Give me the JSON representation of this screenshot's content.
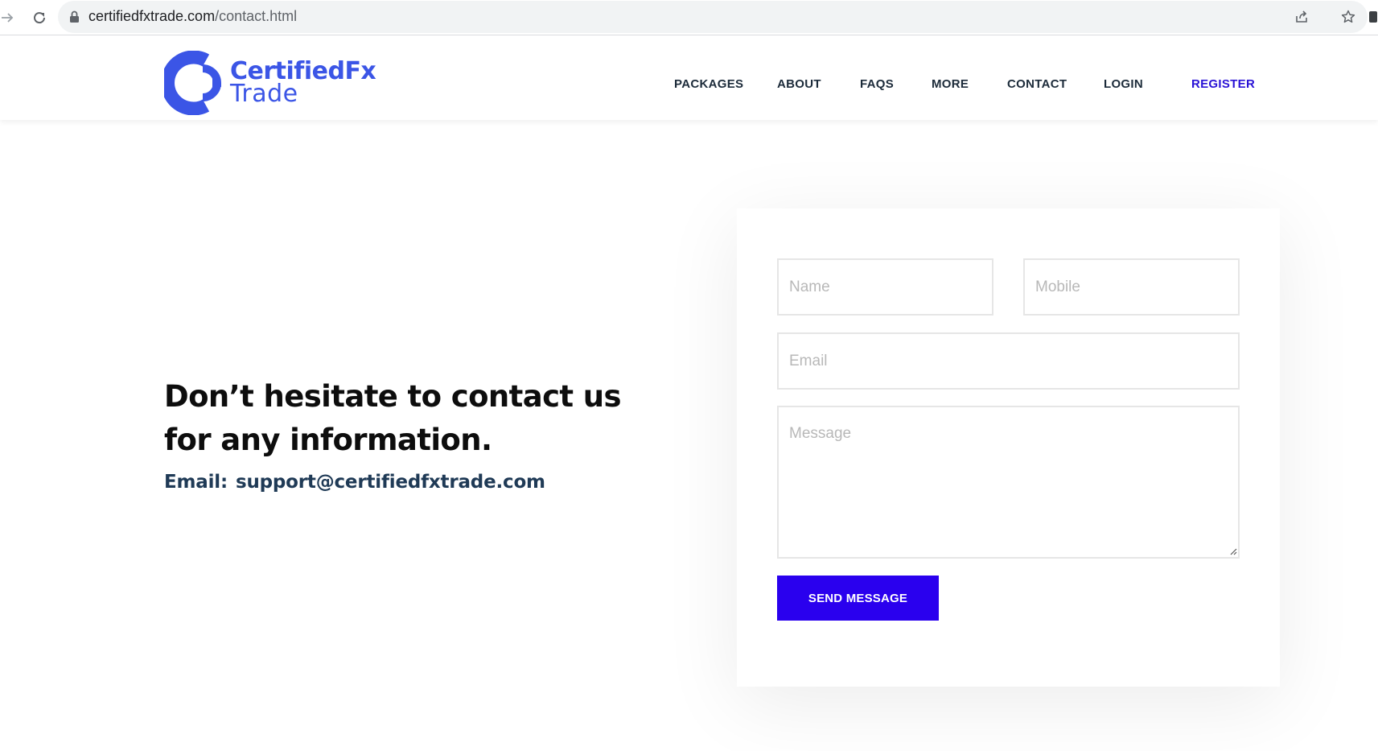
{
  "browser": {
    "url_domain": "certifiedfxtrade.com",
    "url_path": "/contact.html"
  },
  "logo": {
    "line1": "CertifiedFx",
    "line2": "Trade"
  },
  "nav": {
    "items": [
      {
        "label": "PACKAGES"
      },
      {
        "label": "ABOUT"
      },
      {
        "label": "FAQS"
      },
      {
        "label": "MORE"
      },
      {
        "label": "CONTACT"
      },
      {
        "label": "LOGIN"
      },
      {
        "label": "REGISTER"
      }
    ]
  },
  "hero": {
    "headline": "Don’t hesitate to contact us for any information.",
    "email_label": "Email:",
    "email_value": "support@certifiedfxtrade.com"
  },
  "form": {
    "name_placeholder": "Name",
    "mobile_placeholder": "Mobile",
    "email_placeholder": "Email",
    "message_placeholder": "Message",
    "submit_label": "SEND MESSAGE"
  },
  "colors": {
    "brand_blue": "#3b55e6",
    "button_blue": "#2a00ee",
    "register_link": "#2a13d6",
    "nav_text": "#1c2b3a",
    "email_text": "#1f3a56"
  },
  "icons": [
    "forward-icon",
    "reload-icon",
    "lock-icon",
    "share-icon",
    "star-icon",
    "extension-icon"
  ]
}
